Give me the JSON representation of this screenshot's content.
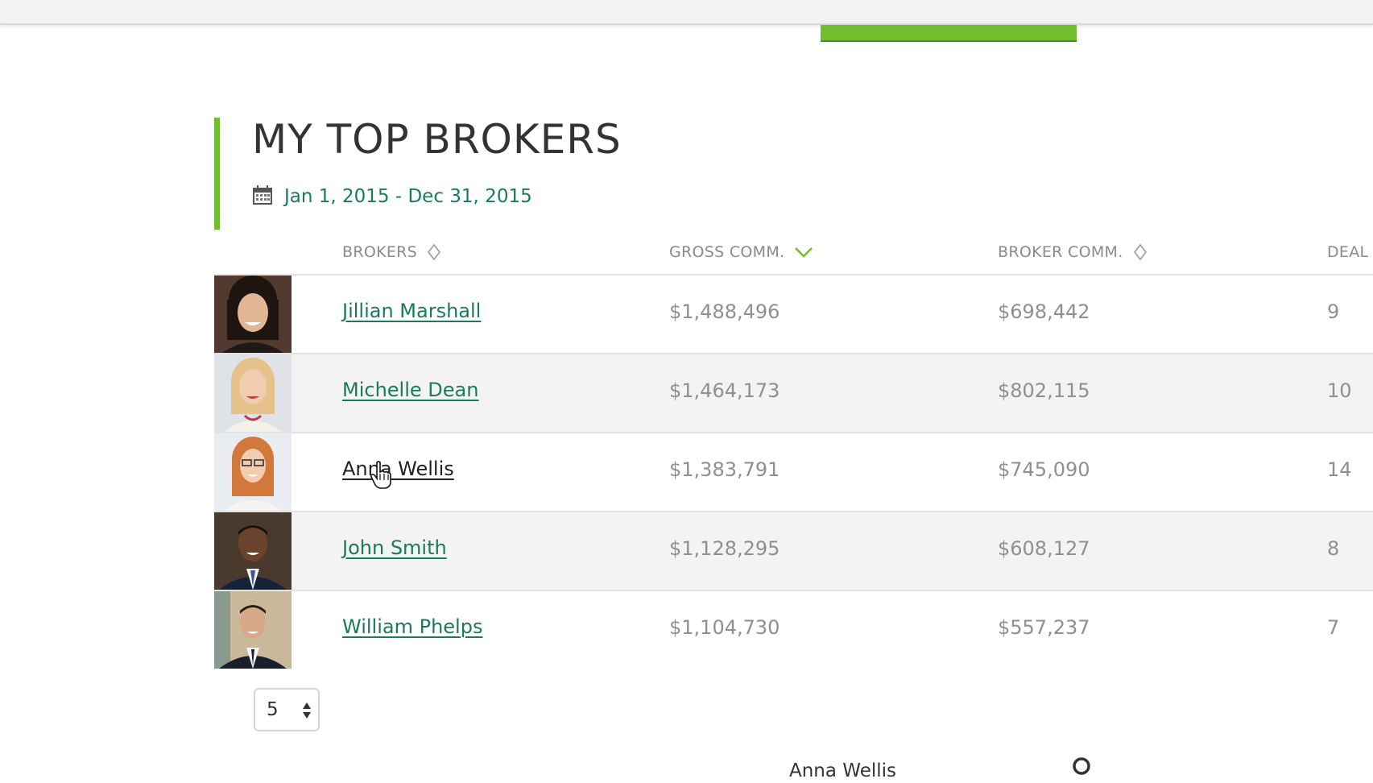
{
  "page": {
    "title": "MY TOP BROKERS",
    "date_range": "Jan 1, 2015 - Dec 31, 2015"
  },
  "colors": {
    "accent_green": "#6ebe2d",
    "link_green": "#1a7a5c",
    "header_text": "#8a8a8a",
    "alt_row": "#f3f3f3"
  },
  "table": {
    "columns": {
      "brokers": "BROKERS",
      "gross": "GROSS COMM.",
      "broker": "BROKER COMM.",
      "deals": "DEAL"
    },
    "sort": {
      "column": "gross",
      "direction": "descending"
    },
    "rows": [
      {
        "name": "Jillian Marshall",
        "gross": "$1,488,496",
        "broker": "$698,442",
        "deals": "9"
      },
      {
        "name": "Michelle Dean",
        "gross": "$1,464,173",
        "broker": "$802,115",
        "deals": "10"
      },
      {
        "name": "Anna Wellis",
        "gross": "$1,383,791",
        "broker": "$745,090",
        "deals": "14"
      },
      {
        "name": "John Smith",
        "gross": "$1,128,295",
        "broker": "$608,127",
        "deals": "8"
      },
      {
        "name": "William Phelps",
        "gross": "$1,104,730",
        "broker": "$557,237",
        "deals": "7"
      }
    ]
  },
  "pagination": {
    "page_size": "5"
  },
  "footer": {
    "selected_name": "Anna Wellis"
  },
  "icons": {
    "calendar": "calendar-icon",
    "sort_neutral": "sort-diamond-icon",
    "sort_desc": "chevron-down-icon",
    "stepper": "updown-stepper-icon",
    "search": "search-icon",
    "cursor": "hand-pointer-icon"
  }
}
